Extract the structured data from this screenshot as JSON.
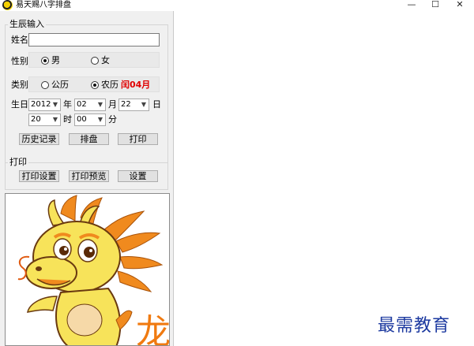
{
  "window": {
    "title": "易天赐八字排盘",
    "minimize_glyph": "—",
    "maximize_glyph": "☐",
    "close_glyph": "✕"
  },
  "birth_input": {
    "group_title": "生辰输入",
    "name_label": "姓名",
    "name_value": "",
    "gender_label": "性别",
    "gender_options": [
      "男",
      "女"
    ],
    "gender_selected": "男",
    "calendar_label": "类别",
    "calendar_options": [
      "公历",
      "农历"
    ],
    "calendar_selected": "农历",
    "leap_month_text": "闰04月",
    "birthday_label": "生日",
    "year_value": "2012",
    "year_unit": "年",
    "month_value": "02",
    "month_unit": "月",
    "day_value": "22",
    "day_unit": "日",
    "hour_value": "20",
    "hour_unit": "时",
    "minute_value": "00",
    "minute_unit": "分",
    "buttons": {
      "history": "历史记录",
      "arrange": "排盘",
      "print": "打印"
    }
  },
  "print_group": {
    "group_title": "打印",
    "buttons": {
      "print_settings": "打印设置",
      "print_preview": "打印预览",
      "settings": "设置"
    }
  },
  "zodiac_image": {
    "icon": "dragon-mascot",
    "character": "龙",
    "colors": {
      "body": "#f7e35a",
      "mane": "#f08a1e",
      "outline": "#6a3a10",
      "character": "#f07a10"
    }
  },
  "watermark": "最需教育",
  "colors": {
    "panel": "#f0f0f0",
    "leap_month": "#e00000",
    "watermark": "#1d3aa0"
  }
}
